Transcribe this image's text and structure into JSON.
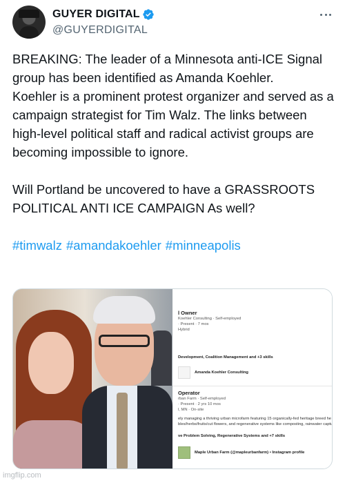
{
  "author": {
    "display_name": "GUYER DIGITAL",
    "handle": "@GUYERDIGITAL",
    "verified_icon": "verified-badge-icon",
    "verified_color": "#1d9bf0"
  },
  "tweet": {
    "line1": "BREAKING: The leader of a Minnesota anti-ICE Signal group has been identified as Amanda Koehler.",
    "line2": "Koehler is a prominent protest organizer and served as a campaign strategist for Tim Walz. The links between high-level political staff and radical activist groups are becoming impossible to ignore.",
    "line3": "Will Portland be uncovered to have a GRASSROOTS POLITICAL ANTI ICE CAMPAIGN As well?",
    "hashtags": [
      "#timwalz",
      "#amandakoehler",
      "#minneapolis"
    ],
    "hashtag_color": "#1d9bf0"
  },
  "profile_card": {
    "job1": {
      "role": "l Owner",
      "company": "Koehler Consulting · Self-employed",
      "dates": "· Present · 7 mos",
      "type": "Hybrid"
    },
    "skills1": "Development, Coalition Management and +3 skills",
    "company_link1": "Amanda Koehler Consulting",
    "job2": {
      "role": "Operator",
      "company": "rban Farm · Self-employed",
      "dates": "· Present · 2 yrs 10 mos",
      "location": "l, MN · On-site"
    },
    "desc_line1": "ely managing a thriving urban microfarm featuring 15 organically-fed heritage breed he",
    "desc_line2": "bles/herbs/fruits/cut flowers, and regenerative systems like composting, rainwater captu",
    "skills2": "ve Problem Solving, Regenerative Systems and +7 skills",
    "company_link2": "Maple Urban Farm (@mapleurbanfarm) • Instagram profile"
  },
  "watermark": "imgflip.com"
}
